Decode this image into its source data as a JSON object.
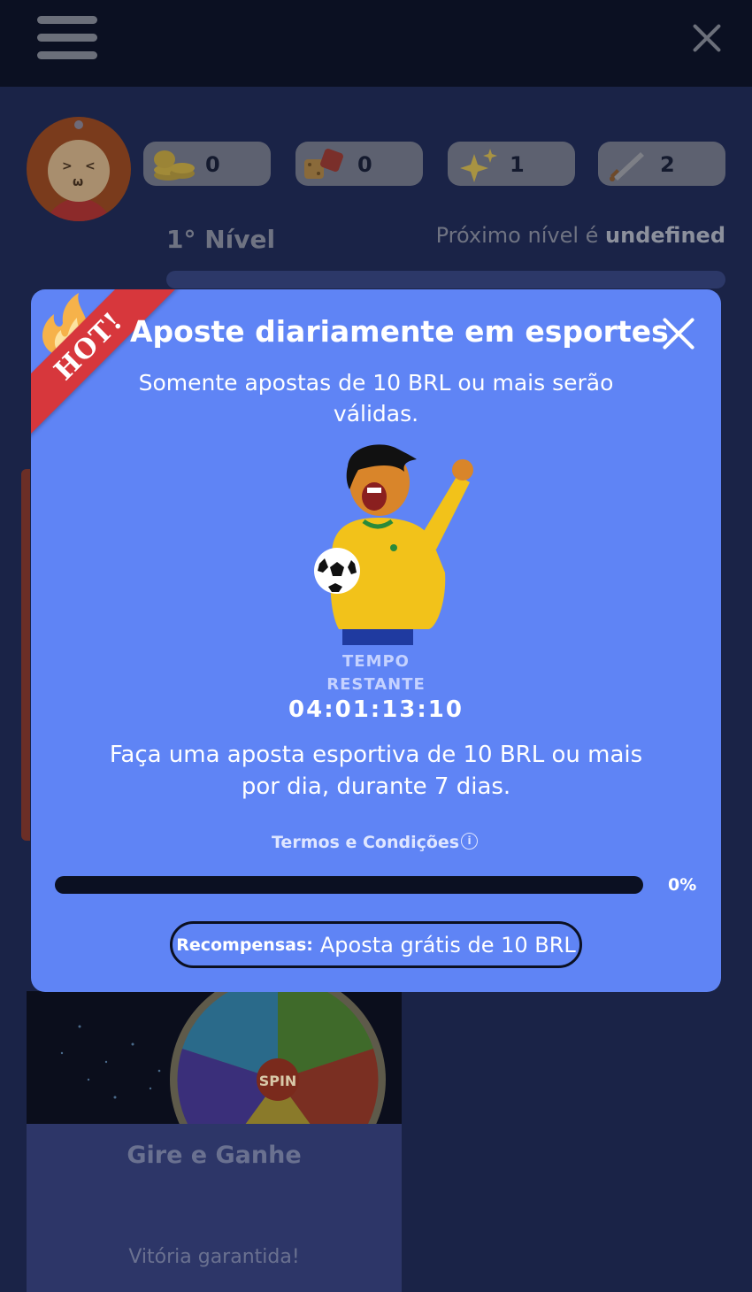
{
  "background": {
    "stats": [
      {
        "icon": "coins-icon",
        "value": "0"
      },
      {
        "icon": "dice-icon",
        "value": "0"
      },
      {
        "icon": "sparkles-icon",
        "value": "1"
      },
      {
        "icon": "sword-icon",
        "value": "2"
      }
    ],
    "level_label": "1° Nível",
    "next_level_prefix": "Próximo nível é ",
    "next_level_value": "undefined",
    "spin_card": {
      "spin_text": "SPIN",
      "title": "Gire e Ganhe",
      "subtitle": "Vitória garantida!"
    }
  },
  "modal": {
    "badge": "HOT!",
    "title": "Aposte diariamente em esportes",
    "subtitle": "Somente apostas de 10 BRL ou mais serão válidas.",
    "time_label_1": "TEMPO",
    "time_label_2": "RESTANTE",
    "timer": "04:01:13:10",
    "description": "Faça uma aposta esportiva de 10 BRL ou mais por dia, durante 7 dias.",
    "terms": "Termos e Condições",
    "progress_percent": 0,
    "progress_label": "0%",
    "reward_key": "Recompensas:",
    "reward_value": "Aposta grátis de 10 BRL"
  },
  "colors": {
    "modal_bg": "#5f84f5",
    "ribbon": "#d7373c",
    "page_bg": "#1a2347",
    "topbar": "#0b1022"
  }
}
